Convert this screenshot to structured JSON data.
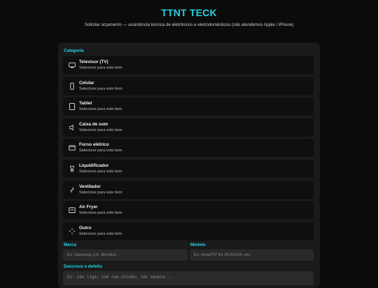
{
  "header": {
    "title": "TTNT TECK",
    "subtitle": "Solicitar orçamento — assistência técnica de eletrônicos e eletrodomésticos (não atendemos Apple / iPhone)"
  },
  "form": {
    "category_label": "Categoria",
    "categories": [
      {
        "title": "Televisor (TV)",
        "subtitle": "Selecione para este item",
        "icon": "tv-icon"
      },
      {
        "title": "Celular",
        "subtitle": "Selecione para este item",
        "icon": "phone-icon"
      },
      {
        "title": "Tablet",
        "subtitle": "Selecione para este item",
        "icon": "tablet-icon"
      },
      {
        "title": "Caixa de som",
        "subtitle": "Selecione para este item",
        "icon": "speaker-icon"
      },
      {
        "title": "Forno elétrico",
        "subtitle": "Selecione para este item",
        "icon": "oven-icon"
      },
      {
        "title": "Liquidificador",
        "subtitle": "Selecione para este item",
        "icon": "blender-icon"
      },
      {
        "title": "Ventilador",
        "subtitle": "Selecione para este item",
        "icon": "fan-icon"
      },
      {
        "title": "Air Fryer",
        "subtitle": "Selecione para este item",
        "icon": "air-fryer-icon"
      },
      {
        "title": "Outro",
        "subtitle": "Selecione para este item",
        "icon": "other-icon"
      }
    ],
    "brand": {
      "label": "Marca",
      "placeholder": "Ex: Samsung, LG, Mondial..."
    },
    "model": {
      "label": "Modelo",
      "placeholder": "Ex: SmartTV 43, BCA1234, etc."
    },
    "defect": {
      "label": "Descreva o defeito",
      "placeholder": "Ex: não liga; som com chiado; não aquece..."
    }
  },
  "colors": {
    "accent": "#25d3e2",
    "panel": "#1a1a1a",
    "card": "#0f0f0f",
    "background": "#0b0b0b"
  }
}
